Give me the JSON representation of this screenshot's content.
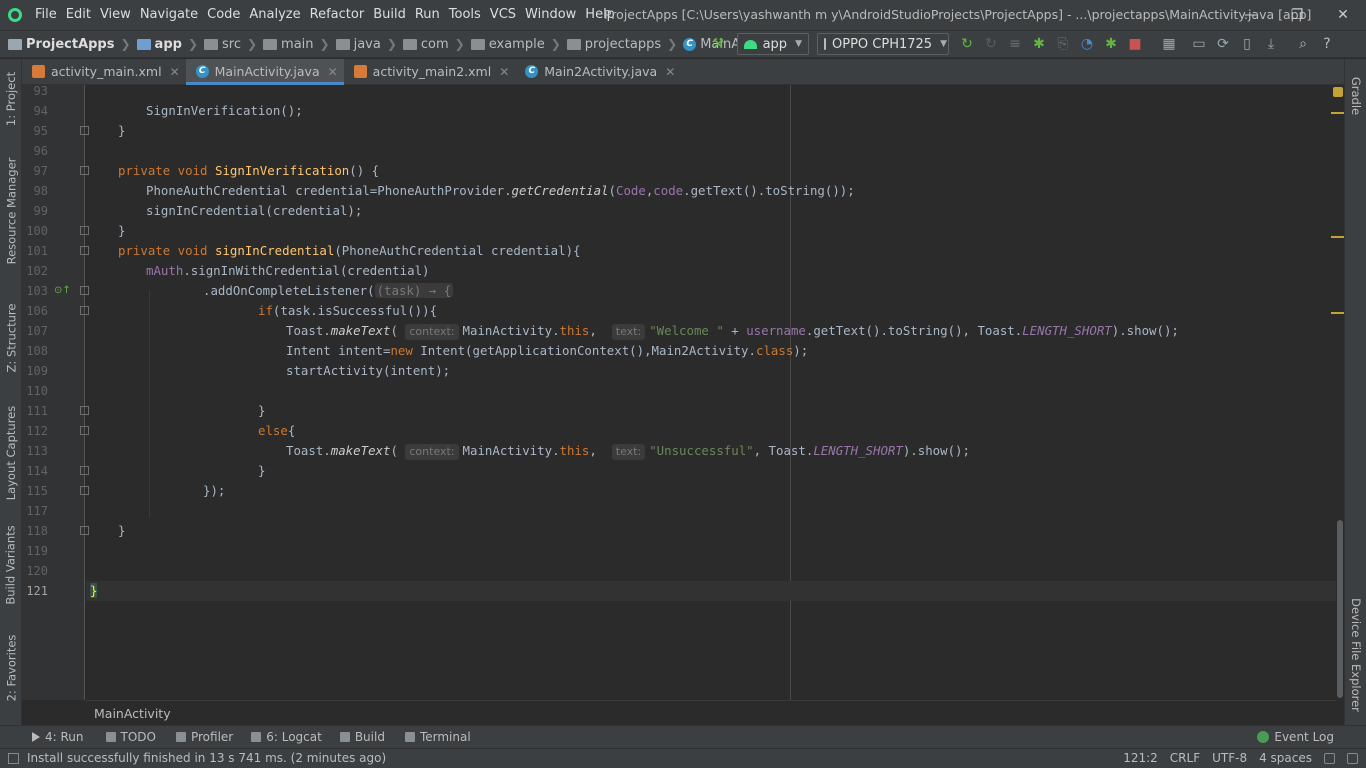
{
  "menu": [
    "File",
    "Edit",
    "View",
    "Navigate",
    "Code",
    "Analyze",
    "Refactor",
    "Build",
    "Run",
    "Tools",
    "VCS",
    "Window",
    "Help"
  ],
  "window_title": "ProjectApps [C:\\Users\\yashwanth m y\\AndroidStudioProjects\\ProjectApps] - ...\\projectapps\\MainActivity.java [app]",
  "window_controls": {
    "minimize": "—",
    "restore": "❐",
    "close": "✕"
  },
  "breadcrumb": [
    "ProjectApps",
    "app",
    "src",
    "main",
    "java",
    "com",
    "example",
    "projectapps",
    "MainActivity"
  ],
  "run_config": "app",
  "device": "OPPO CPH1725",
  "tabs": [
    {
      "label": "activity_main.xml",
      "active": false
    },
    {
      "label": "MainActivity.java",
      "active": true
    },
    {
      "label": "activity_main2.xml",
      "active": false
    },
    {
      "label": "Main2Activity.java",
      "active": false
    }
  ],
  "left_tools": [
    "1: Project",
    "Resource Manager",
    "Z: Structure",
    "Layout Captures",
    "Build Variants",
    "2: Favorites"
  ],
  "right_tools": [
    "Gradle",
    "Device File Explorer"
  ],
  "line_numbers": [
    "93",
    "94",
    "95",
    "96",
    "97",
    "98",
    "99",
    "100",
    "101",
    "102",
    "103",
    "106",
    "107",
    "108",
    "109",
    "110",
    "111",
    "112",
    "113",
    "114",
    "115",
    "117",
    "118",
    "119",
    "120",
    "121"
  ],
  "code": {
    "l94": "SignInVerification();",
    "l95": "}",
    "l97_kw": "private void ",
    "l97_name": "SignInVerification",
    "l97_rest": "() {",
    "l98_a": "PhoneAuthCredential credential=PhoneAuthProvider.",
    "l98_m": "getCredential",
    "l98_b": "(",
    "l98_f1": "Code",
    "l98_c": ",",
    "l98_f2": "code",
    "l98_d": ".getText().toString());",
    "l99": "signInCredential(credential);",
    "l100": "}",
    "l101_kw": "private void ",
    "l101_name": "signInCredential",
    "l101_rest": "(PhoneAuthCredential credential){",
    "l102_f": "mAuth",
    "l102_rest": ".signInWithCredential(credential)",
    "l103_a": ".addOnCompleteListener(",
    "l103_lam": "(task) → {",
    "l106_kw": "if",
    "l106_rest": "(task.isSuccessful()){",
    "l107_a": "Toast.",
    "l107_m": "makeText",
    "l107_b": "( ",
    "hint_context": "context:",
    "l107_c": "MainActivity.",
    "kw_this": "this",
    "l107_d": ",  ",
    "hint_text": "text:",
    "l107_s": "\"Welcome \"",
    "l107_e": " + ",
    "l107_f": "username",
    "l107_g": ".getText().toString(), Toast.",
    "l107_h": "LENGTH_SHORT",
    "l107_i": ").show();",
    "l108_a": "Intent intent=",
    "l108_kw": "new",
    "l108_b": " Intent(getApplicationContext(),Main2Activity.",
    "l108_kw2": "class",
    "l108_c": ");",
    "l109": "startActivity(intent);",
    "l111": "}",
    "l112_kw": "else",
    "l112_rest": "{",
    "l113_s": "\"Unsuccessful\"",
    "l113_g": ", Toast.",
    "l114": "}",
    "l115": "});",
    "l118": "}",
    "l121": "}"
  },
  "footer_crumb": "MainActivity",
  "bottom_tools": [
    "4: Run",
    "TODO",
    "Profiler",
    "6: Logcat",
    "Build",
    "Terminal"
  ],
  "event_log": "Event Log",
  "status": {
    "message": "Install successfully finished in 13 s 741 ms. (2 minutes ago)",
    "position": "121:2",
    "line_sep": "CRLF",
    "encoding": "UTF-8",
    "indent": "4 spaces"
  },
  "colors": {
    "background": "#2b2b2b",
    "keyword": "#cc7832",
    "method": "#ffc66d",
    "string": "#6a8759",
    "field": "#9876aa",
    "accent": "#4a88c7"
  }
}
